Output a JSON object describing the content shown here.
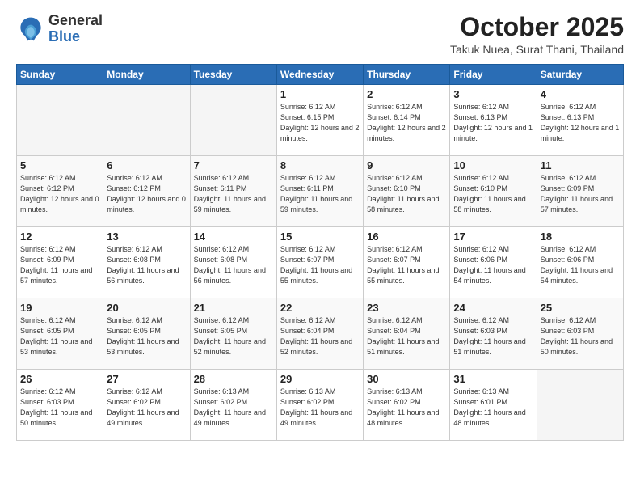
{
  "logo": {
    "line1": "General",
    "line2": "Blue"
  },
  "header": {
    "month": "October 2025",
    "location": "Takuk Nuea, Surat Thani, Thailand"
  },
  "weekdays": [
    "Sunday",
    "Monday",
    "Tuesday",
    "Wednesday",
    "Thursday",
    "Friday",
    "Saturday"
  ],
  "weeks": [
    [
      {
        "day": "",
        "info": ""
      },
      {
        "day": "",
        "info": ""
      },
      {
        "day": "",
        "info": ""
      },
      {
        "day": "1",
        "info": "Sunrise: 6:12 AM\nSunset: 6:15 PM\nDaylight: 12 hours\nand 2 minutes."
      },
      {
        "day": "2",
        "info": "Sunrise: 6:12 AM\nSunset: 6:14 PM\nDaylight: 12 hours\nand 2 minutes."
      },
      {
        "day": "3",
        "info": "Sunrise: 6:12 AM\nSunset: 6:13 PM\nDaylight: 12 hours\nand 1 minute."
      },
      {
        "day": "4",
        "info": "Sunrise: 6:12 AM\nSunset: 6:13 PM\nDaylight: 12 hours\nand 1 minute."
      }
    ],
    [
      {
        "day": "5",
        "info": "Sunrise: 6:12 AM\nSunset: 6:12 PM\nDaylight: 12 hours\nand 0 minutes."
      },
      {
        "day": "6",
        "info": "Sunrise: 6:12 AM\nSunset: 6:12 PM\nDaylight: 12 hours\nand 0 minutes."
      },
      {
        "day": "7",
        "info": "Sunrise: 6:12 AM\nSunset: 6:11 PM\nDaylight: 11 hours\nand 59 minutes."
      },
      {
        "day": "8",
        "info": "Sunrise: 6:12 AM\nSunset: 6:11 PM\nDaylight: 11 hours\nand 59 minutes."
      },
      {
        "day": "9",
        "info": "Sunrise: 6:12 AM\nSunset: 6:10 PM\nDaylight: 11 hours\nand 58 minutes."
      },
      {
        "day": "10",
        "info": "Sunrise: 6:12 AM\nSunset: 6:10 PM\nDaylight: 11 hours\nand 58 minutes."
      },
      {
        "day": "11",
        "info": "Sunrise: 6:12 AM\nSunset: 6:09 PM\nDaylight: 11 hours\nand 57 minutes."
      }
    ],
    [
      {
        "day": "12",
        "info": "Sunrise: 6:12 AM\nSunset: 6:09 PM\nDaylight: 11 hours\nand 57 minutes."
      },
      {
        "day": "13",
        "info": "Sunrise: 6:12 AM\nSunset: 6:08 PM\nDaylight: 11 hours\nand 56 minutes."
      },
      {
        "day": "14",
        "info": "Sunrise: 6:12 AM\nSunset: 6:08 PM\nDaylight: 11 hours\nand 56 minutes."
      },
      {
        "day": "15",
        "info": "Sunrise: 6:12 AM\nSunset: 6:07 PM\nDaylight: 11 hours\nand 55 minutes."
      },
      {
        "day": "16",
        "info": "Sunrise: 6:12 AM\nSunset: 6:07 PM\nDaylight: 11 hours\nand 55 minutes."
      },
      {
        "day": "17",
        "info": "Sunrise: 6:12 AM\nSunset: 6:06 PM\nDaylight: 11 hours\nand 54 minutes."
      },
      {
        "day": "18",
        "info": "Sunrise: 6:12 AM\nSunset: 6:06 PM\nDaylight: 11 hours\nand 54 minutes."
      }
    ],
    [
      {
        "day": "19",
        "info": "Sunrise: 6:12 AM\nSunset: 6:05 PM\nDaylight: 11 hours\nand 53 minutes."
      },
      {
        "day": "20",
        "info": "Sunrise: 6:12 AM\nSunset: 6:05 PM\nDaylight: 11 hours\nand 53 minutes."
      },
      {
        "day": "21",
        "info": "Sunrise: 6:12 AM\nSunset: 6:05 PM\nDaylight: 11 hours\nand 52 minutes."
      },
      {
        "day": "22",
        "info": "Sunrise: 6:12 AM\nSunset: 6:04 PM\nDaylight: 11 hours\nand 52 minutes."
      },
      {
        "day": "23",
        "info": "Sunrise: 6:12 AM\nSunset: 6:04 PM\nDaylight: 11 hours\nand 51 minutes."
      },
      {
        "day": "24",
        "info": "Sunrise: 6:12 AM\nSunset: 6:03 PM\nDaylight: 11 hours\nand 51 minutes."
      },
      {
        "day": "25",
        "info": "Sunrise: 6:12 AM\nSunset: 6:03 PM\nDaylight: 11 hours\nand 50 minutes."
      }
    ],
    [
      {
        "day": "26",
        "info": "Sunrise: 6:12 AM\nSunset: 6:03 PM\nDaylight: 11 hours\nand 50 minutes."
      },
      {
        "day": "27",
        "info": "Sunrise: 6:12 AM\nSunset: 6:02 PM\nDaylight: 11 hours\nand 49 minutes."
      },
      {
        "day": "28",
        "info": "Sunrise: 6:13 AM\nSunset: 6:02 PM\nDaylight: 11 hours\nand 49 minutes."
      },
      {
        "day": "29",
        "info": "Sunrise: 6:13 AM\nSunset: 6:02 PM\nDaylight: 11 hours\nand 49 minutes."
      },
      {
        "day": "30",
        "info": "Sunrise: 6:13 AM\nSunset: 6:02 PM\nDaylight: 11 hours\nand 48 minutes."
      },
      {
        "day": "31",
        "info": "Sunrise: 6:13 AM\nSunset: 6:01 PM\nDaylight: 11 hours\nand 48 minutes."
      },
      {
        "day": "",
        "info": ""
      }
    ]
  ]
}
